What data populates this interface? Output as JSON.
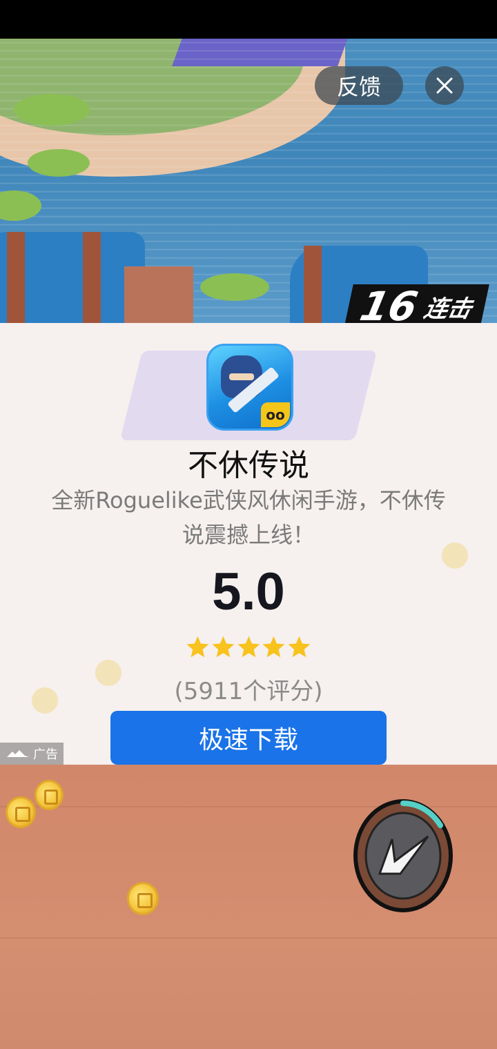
{
  "top_bar": {
    "feedback_label": "反馈"
  },
  "game_overlay": {
    "combo_number": "16",
    "combo_label": "连击"
  },
  "ad_card": {
    "app_name": "不休传说",
    "description": "全新Roguelike武侠风休闲手游，不休传说震撼上线！",
    "rating": "5.0",
    "stars": 5,
    "rating_count": "(5911个评分)",
    "download_label": "极速下载",
    "ad_badge": "广告"
  },
  "colors": {
    "download_button": "#1a73e8",
    "star": "#f8c21f",
    "card_background": "#f6f0ee"
  },
  "icons": [
    "close-icon",
    "star-icon",
    "app-icon",
    "skill-dash-icon",
    "ad-logo-icon"
  ]
}
